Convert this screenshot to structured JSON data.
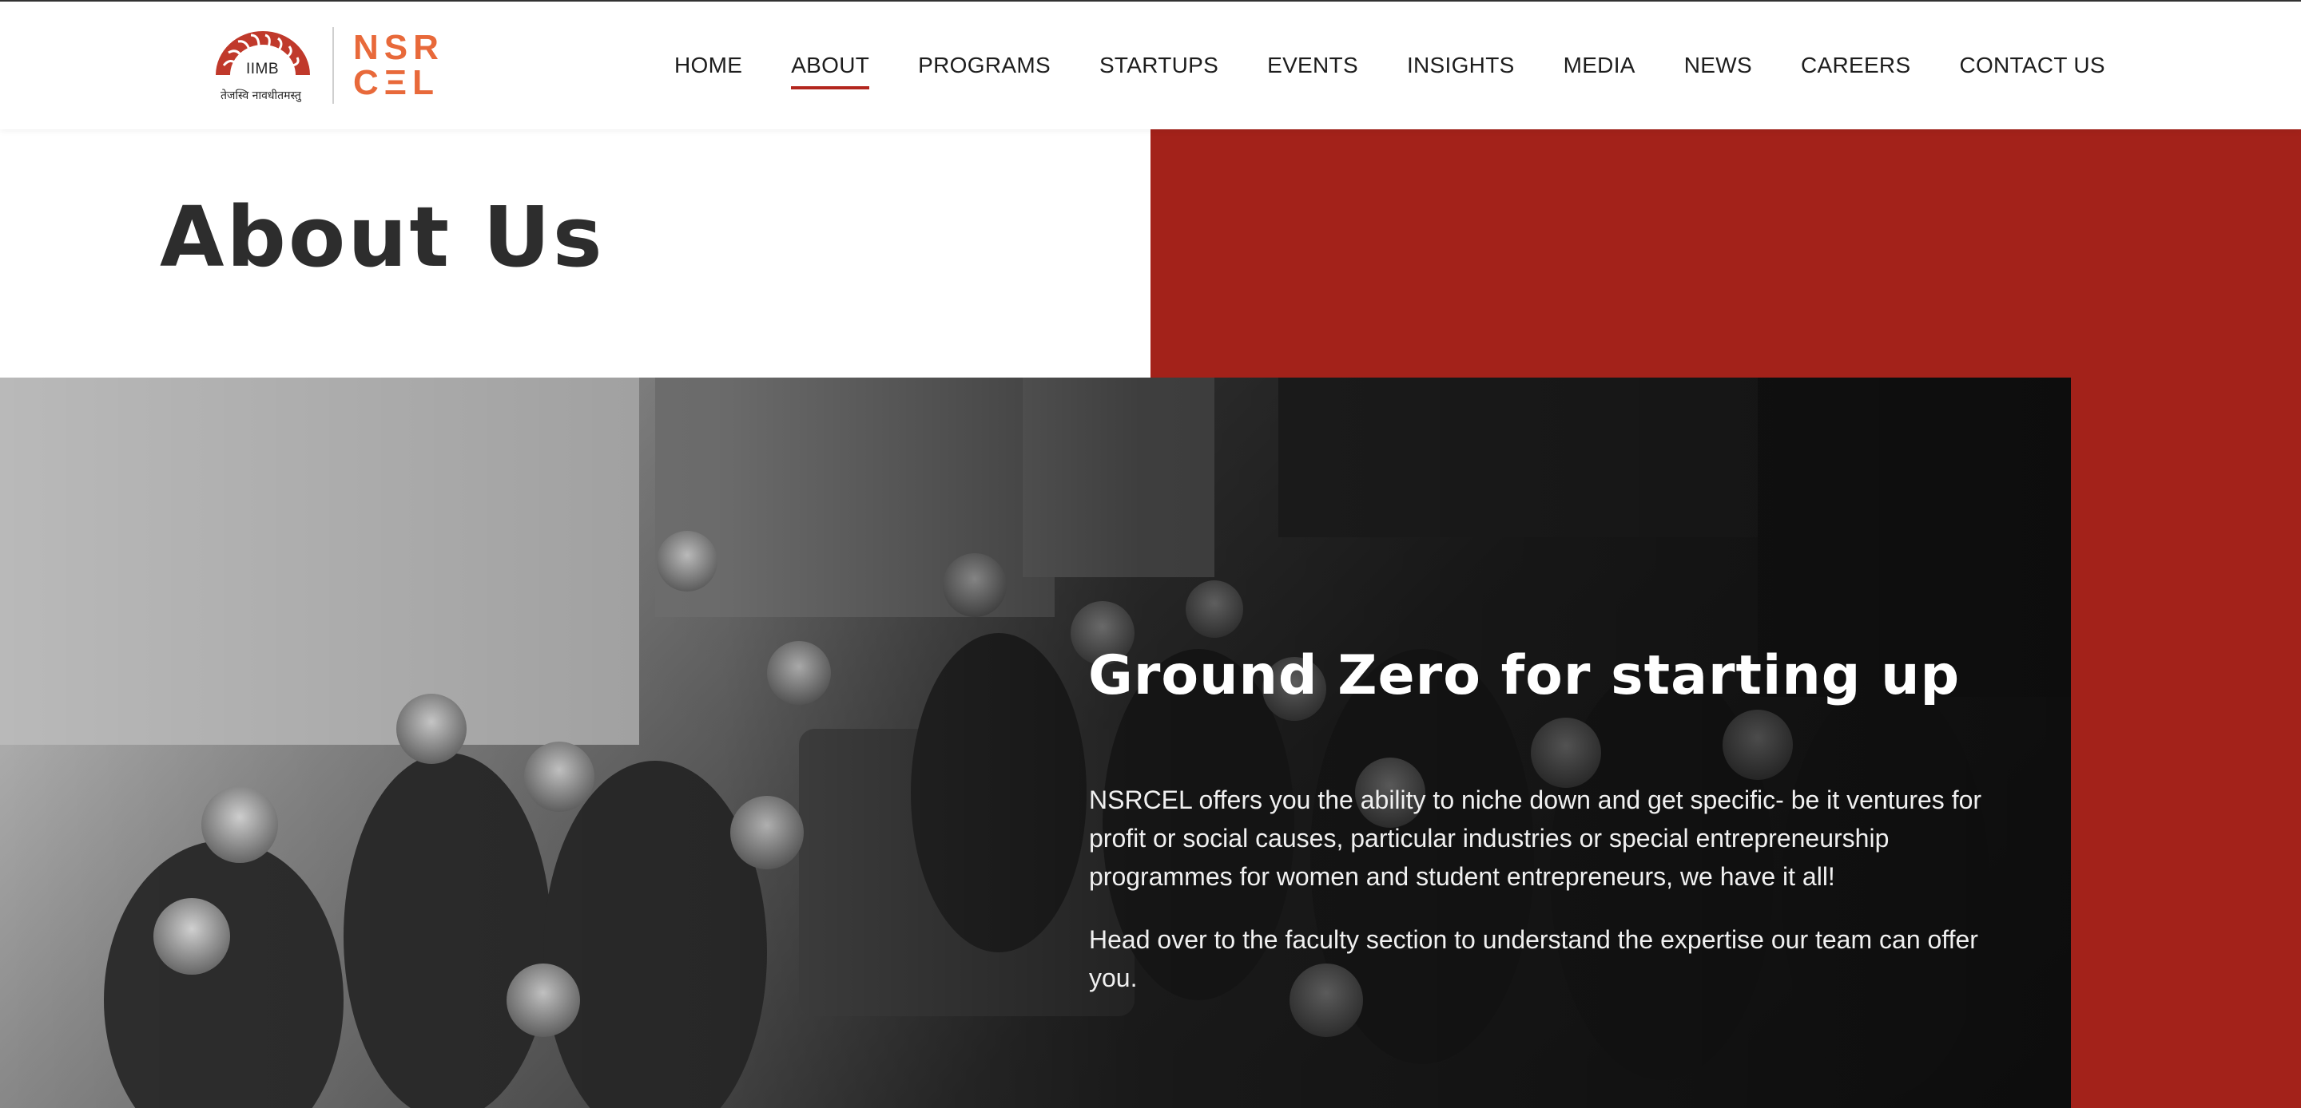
{
  "brand": {
    "iimb_text": "IIMB",
    "iimb_motto": "तेजस्वि नावधीतमस्तु",
    "nsrcel_top": "NSR",
    "nsrcel_bottom": "CΞL",
    "colors": {
      "iimb_red": "#c0392b",
      "nsrcel_orange": "#e8693a"
    }
  },
  "nav": {
    "items": [
      {
        "label": "HOME"
      },
      {
        "label": "ABOUT",
        "active": true
      },
      {
        "label": "PROGRAMS"
      },
      {
        "label": "STARTUPS"
      },
      {
        "label": "EVENTS"
      },
      {
        "label": "INSIGHTS"
      },
      {
        "label": "MEDIA"
      },
      {
        "label": "NEWS"
      },
      {
        "label": "CAREERS"
      },
      {
        "label": "CONTACT US"
      }
    ]
  },
  "page": {
    "title": "About Us",
    "accent_color": "#a3221a"
  },
  "hero": {
    "heading": "Ground Zero for starting up",
    "paragraph_1": "NSRCEL offers you the ability to niche down and get specific- be it ventures for profit or social causes, particular industries or special entrepreneurship programmes for women and student entrepreneurs, we have it all!",
    "paragraph_2": "Head over to the faculty section to understand the expertise our team can offer you."
  }
}
